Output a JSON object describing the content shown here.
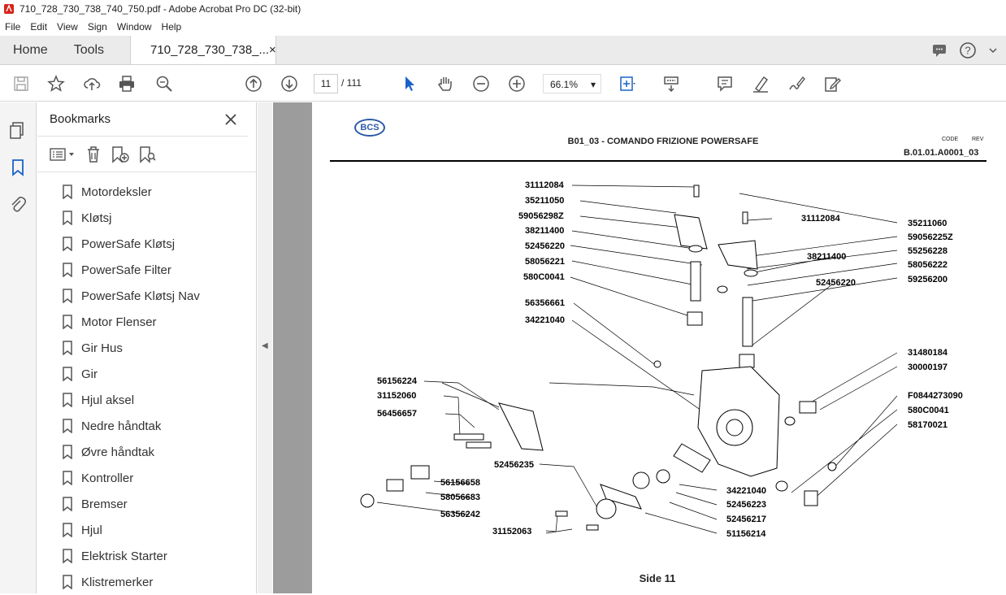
{
  "window": {
    "title": "710_728_730_738_740_750.pdf - Adobe Acrobat Pro DC (32-bit)"
  },
  "menu": [
    "File",
    "Edit",
    "View",
    "Sign",
    "Window",
    "Help"
  ],
  "tabs": {
    "home": "Home",
    "tools": "Tools",
    "document": "710_728_730_738_...",
    "close": "×"
  },
  "toolbar": {
    "current_page": "11",
    "total_pages": "/ 111",
    "zoom": "66.1%"
  },
  "bookmarks": {
    "title": "Bookmarks",
    "items": [
      "Motordeksler",
      "Kløtsj",
      "PowerSafe Kløtsj",
      "PowerSafe Filter",
      "PowerSafe Kløtsj Nav",
      "Motor Flenser",
      "Gir Hus",
      "Gir",
      "Hjul aksel",
      "Nedre håndtak",
      "Øvre håndtak",
      "Kontroller",
      "Bremser",
      "Hjul",
      "Elektrisk Starter",
      "Klistremerker"
    ]
  },
  "document": {
    "logo": "BCS",
    "title": "B01_03 - COMANDO FRIZIONE POWERSAFE",
    "code_label": "CODE",
    "rev_label": "REV",
    "code_value": "B.01.01.A0001_03",
    "footer": "Side 11",
    "parts_left": [
      "31112084",
      "35211050",
      "59056298Z",
      "38211400",
      "52456220",
      "58056221",
      "580C0041",
      "56356661",
      "34221040"
    ],
    "parts_center": [
      "31112084",
      "38211400",
      "52456220"
    ],
    "parts_right": [
      "35211060",
      "59056225Z",
      "55256228",
      "58056222",
      "59256200",
      "31480184",
      "30000197",
      "F0844273090",
      "580C0041",
      "58170021"
    ],
    "parts_lower_left": [
      "56156224",
      "31152060",
      "56456657",
      "56156658",
      "58056683",
      "56356242",
      "52456235",
      "31152063"
    ],
    "parts_lower_right": [
      "34221040",
      "52456223",
      "52456217",
      "51156214"
    ]
  }
}
